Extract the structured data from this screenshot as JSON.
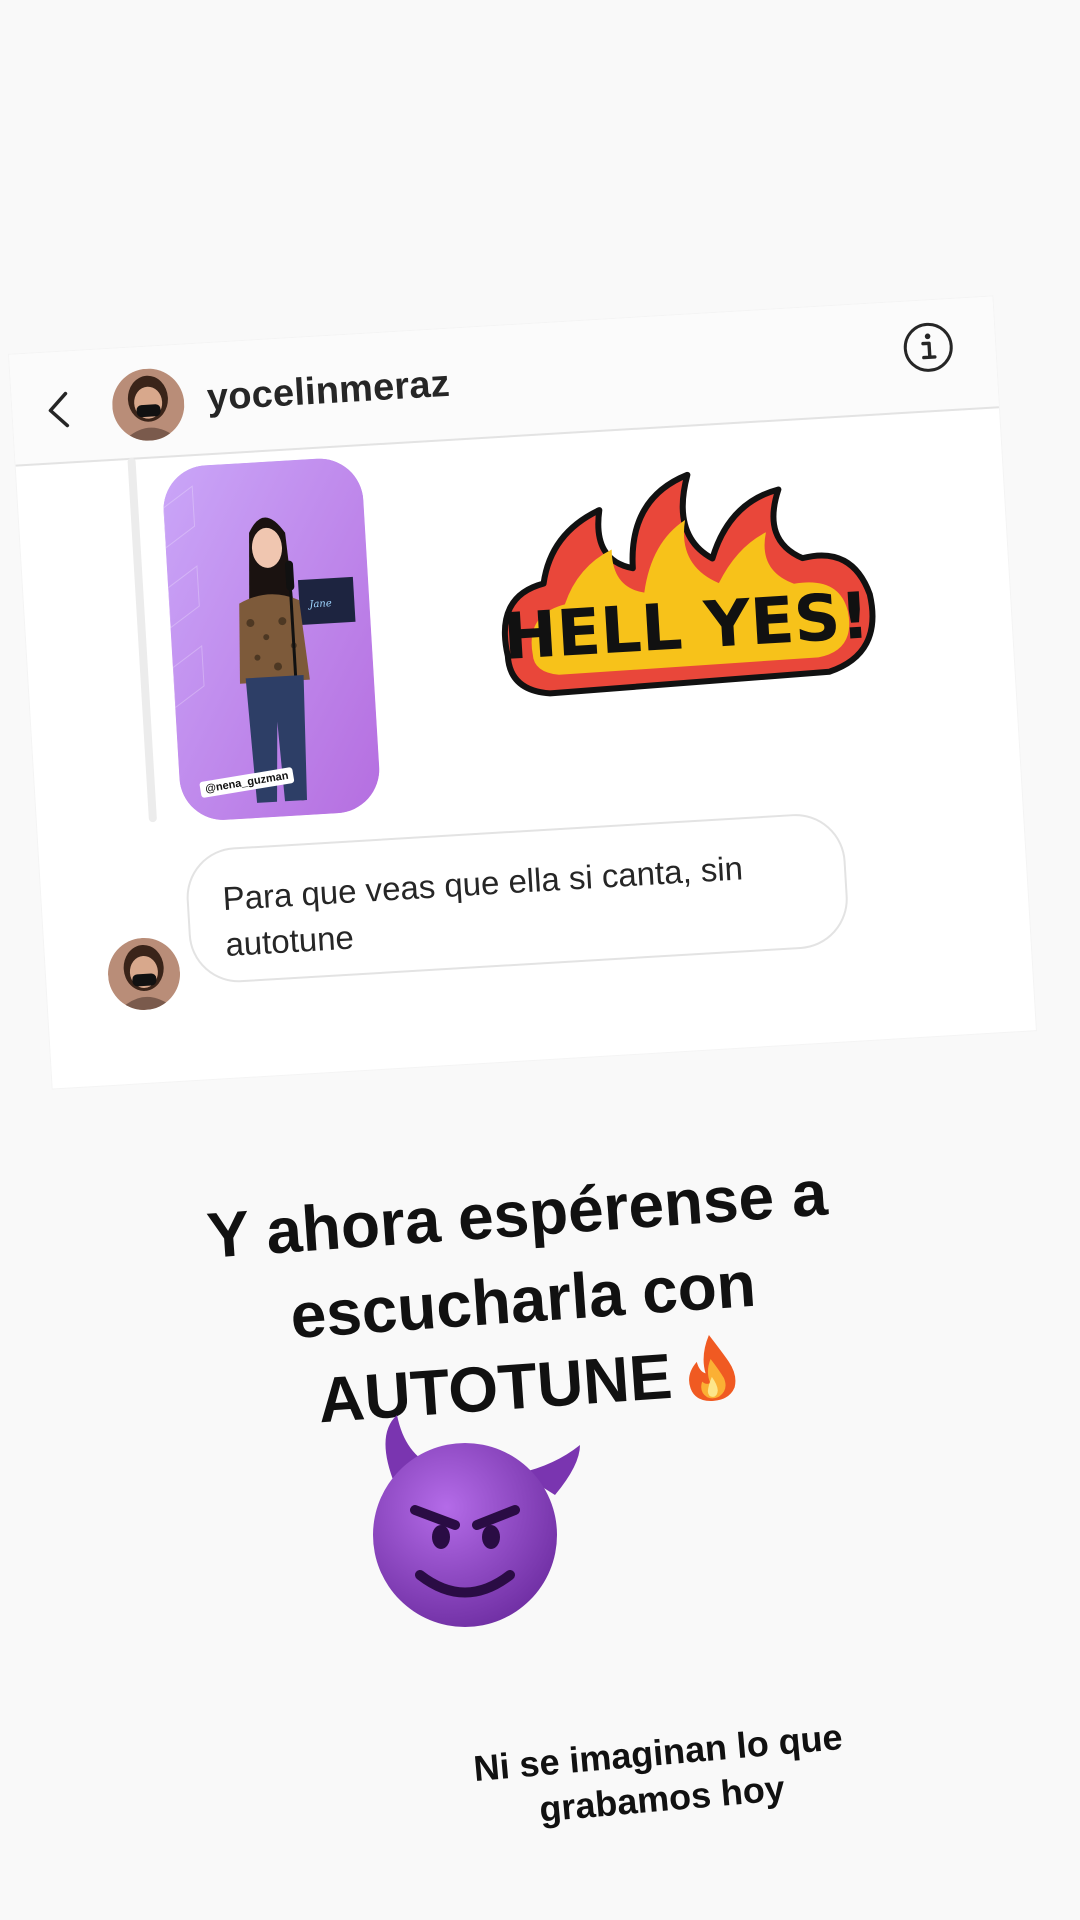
{
  "dm": {
    "username": "yocelinmeraz",
    "shared_post": {
      "credit": "@nena_guzman"
    },
    "sticker": {
      "text": "HELL YES!"
    },
    "message": {
      "text": "Para que veas que ella si canta, sin autotune"
    }
  },
  "captions": {
    "main": "Y ahora espérense a\nescucharla con\nAUTOTUNE",
    "bottom": "Ni se imaginan lo que\ngrabamos hoy"
  },
  "icons": {
    "back": "chevron-left-icon",
    "info": "info-icon",
    "fire": "fire-emoji",
    "devil": "smiling-devil-emoji"
  },
  "colors": {
    "text": "#262626",
    "border": "#e3e3e3",
    "sticker_red": "#e9473a",
    "sticker_yellow": "#f7c21a",
    "devil_purple": "#8a3fc2"
  }
}
